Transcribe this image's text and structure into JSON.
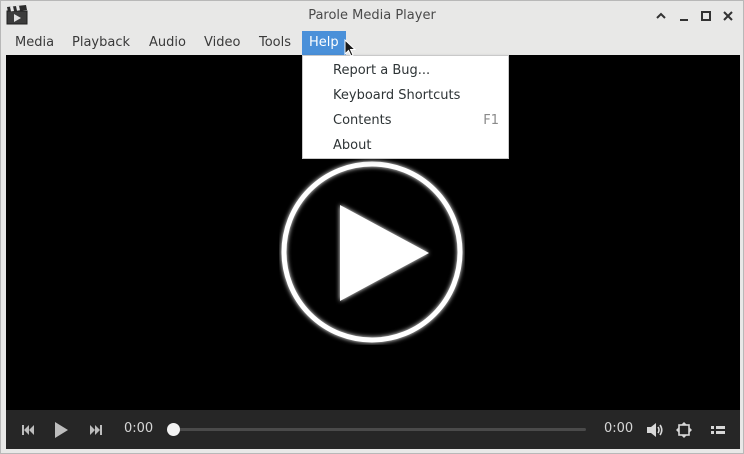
{
  "window": {
    "title": "Parole Media Player"
  },
  "menubar": {
    "items": [
      "Media",
      "Playback",
      "Audio",
      "Video",
      "Tools",
      "Help"
    ],
    "active": "Help"
  },
  "help_menu": {
    "items": [
      {
        "label": "Report a Bug...",
        "accel": ""
      },
      {
        "label": "Keyboard Shortcuts",
        "accel": ""
      },
      {
        "label": "Contents",
        "accel": "F1"
      },
      {
        "label": "About",
        "accel": ""
      }
    ]
  },
  "controls": {
    "current_time": "0:00",
    "duration": "0:00",
    "seek_progress": 0
  },
  "icons": {
    "app": "clapperboard-icon",
    "minimize": "minimize-icon",
    "maximize": "maximize-icon",
    "close": "close-icon",
    "roll_up": "chevron-up-icon",
    "prev": "skip-previous-icon",
    "play": "play-icon",
    "next": "skip-next-icon",
    "volume": "volume-icon",
    "fullscreen": "fullscreen-icon",
    "playlist": "playlist-icon"
  },
  "colors": {
    "menu_active": "#4a90d9",
    "video_bg": "#000000",
    "controls_bg": "#262626"
  }
}
